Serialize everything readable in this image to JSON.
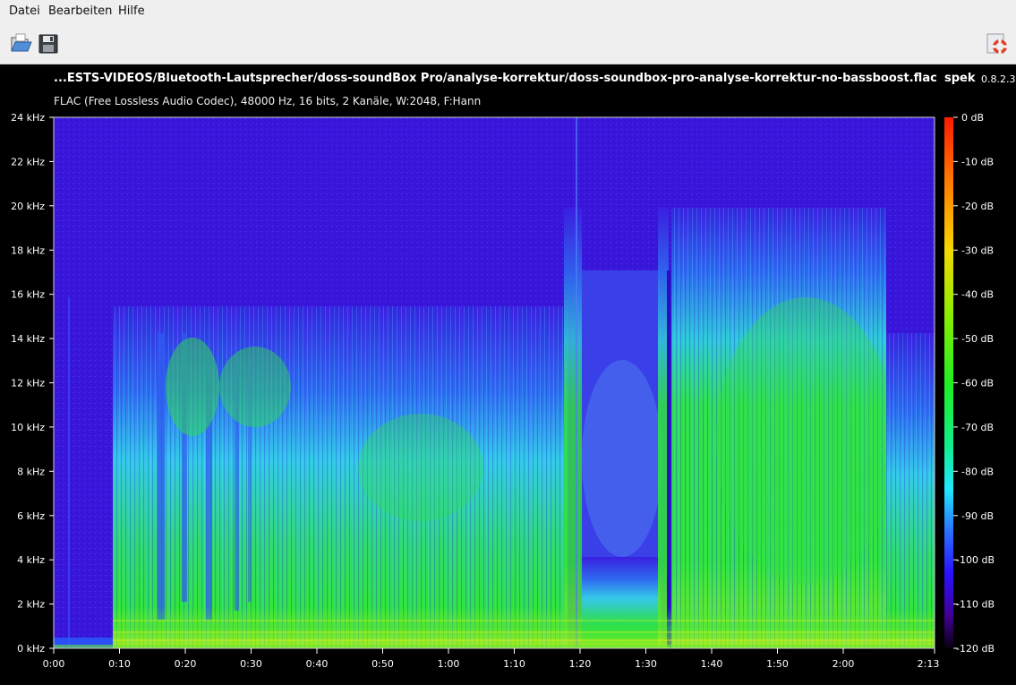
{
  "menubar": {
    "items": [
      "Datei",
      "Bearbeiten",
      "Hilfe"
    ]
  },
  "toolbar": {
    "open_icon": "open-file-icon",
    "save_icon": "save-icon",
    "help_icon": "lifebuoy-help-icon"
  },
  "header": {
    "file_title": "...ESTS-VIDEOS/Bluetooth-Lautsprecher/doss-soundBox Pro/analyse-korrektur/doss-soundbox-pro-analyse-korrektur-no-bassboost.flac",
    "app_name": "spek",
    "app_version": "0.8.2.3",
    "file_info": "FLAC (Free Lossless Audio Codec), 48000 Hz, 16 bits, 2 Kanäle, W:2048, F:Hann"
  },
  "spectrogram": {
    "freq_labels": [
      "0 kHz",
      "2 kHz",
      "4 kHz",
      "6 kHz",
      "8 kHz",
      "10 kHz",
      "12 kHz",
      "14 kHz",
      "16 kHz",
      "18 kHz",
      "20 kHz",
      "22 kHz",
      "24 kHz"
    ],
    "time_labels": [
      "0:00",
      "0:10",
      "0:20",
      "0:30",
      "0:40",
      "0:50",
      "1:00",
      "1:10",
      "1:20",
      "1:30",
      "1:40",
      "1:50",
      "2:00",
      "2:13"
    ],
    "db_labels": [
      "0 dB",
      "-10 dB",
      "-20 dB",
      "-30 dB",
      "-40 dB",
      "-50 dB",
      "-60 dB",
      "-70 dB",
      "-80 dB",
      "-90 dB",
      "-100 dB",
      "-110 dB",
      "-120 dB"
    ],
    "colors": {
      "background": "#3a12d8",
      "low": "#1a0a8a",
      "mid_blue": "#2f4ff0",
      "cyan": "#2fd8e8",
      "green": "#29e33a",
      "yellow_green": "#b8ee20"
    }
  }
}
